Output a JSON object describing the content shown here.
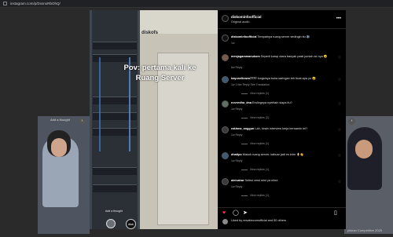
{
  "browser": {
    "url": "instagram.com/p/DxsnoRbOhQ/"
  },
  "post": {
    "username": "diskominfoofficial",
    "audio": "Original audio",
    "caption_line1": "Pov: pertama kali ke",
    "caption_line2": "Ruang Server",
    "watermark": "diskofs",
    "add_label": "Add a thought",
    "avatar_text": "disk"
  },
  "comments": [
    {
      "user": "diskominfoofficial",
      "text": "Tempatnya ruang server sedingin itu ❄️",
      "meta": "1w",
      "replies": ""
    },
    {
      "user": "mesjagaramanukom",
      "text": "Seperti kutup utara banyak pasti jumlah ac nya 😄",
      "meta": "6w  Reply",
      "replies": ""
    },
    {
      "user": "bayuselbowo7777",
      "text": "fungsinya buka saringan teh buat apa yo 😂",
      "meta": "1w  1 like  Reply  See Translation",
      "replies": "View replies (1)"
    },
    {
      "user": "novredha_dna",
      "text": "Endingnya nyeritain siapa itu?",
      "meta": "1w  Reply",
      "replies": "View replies (2)"
    },
    {
      "user": "rakhma_anggun",
      "text": "Lah, kirain interview kerja bernamin ini?",
      "meta": "1w  Reply",
      "replies": "View replies (1)"
    },
    {
      "user": "dhatipo",
      "text": "Masuk ruang server, kabuar jadi es krim 🍦👋",
      "meta": "1w  Reply",
      "replies": "View replies (1)"
    },
    {
      "user": "aleisahar",
      "text": "Selesi versi mini ya mind",
      "meta": "1w  Reply",
      "replies": "View replies (1)"
    }
  ],
  "footer": {
    "likes": "Liked by nnsafarcomofficial and 50 others"
  },
  "background": {
    "left_caption": "Add a thought",
    "right_caption": "pikiran Competitive 2025"
  },
  "icons": [
    "heart-icon",
    "comment-icon",
    "share-icon",
    "bookmark-icon",
    "more-icon",
    "chevron-left-icon",
    "chevron-right-icon"
  ]
}
